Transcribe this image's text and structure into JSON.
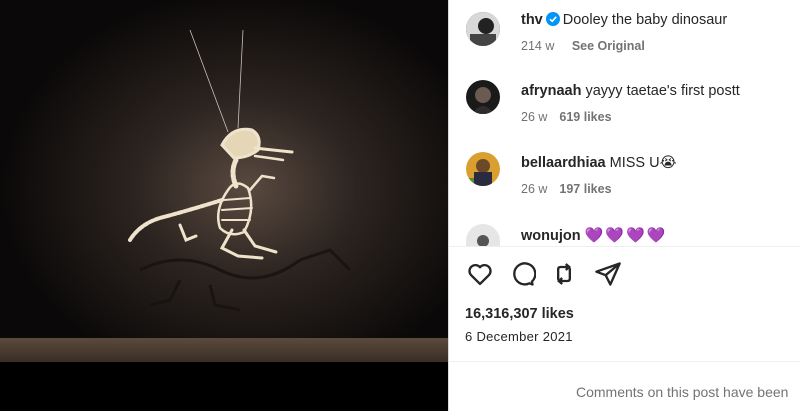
{
  "media": {
    "alt_subject": "dinosaur-skeleton-model"
  },
  "caption": {
    "username": "thv",
    "text": "Dooley the baby dinosaur",
    "time": "214 w",
    "see_original": "See Original",
    "verified_color": "#0095f6"
  },
  "comments": [
    {
      "username": "afrynaah",
      "text": "yayyy taetae's first postt",
      "time": "26 w",
      "likes": "619 likes"
    },
    {
      "username": "bellaardhiaa",
      "text": "MISS U😭",
      "time": "26 w",
      "likes": "197 likes"
    },
    {
      "username": "wonujon",
      "text": "💜💜💜💜"
    }
  ],
  "actions": {
    "like_icon": "heart-outline-icon",
    "comment_icon": "speech-bubble-icon",
    "repost_icon": "repost-arrows-icon",
    "share_icon": "paper-plane-icon"
  },
  "stats": {
    "likes": "16,316,307 likes",
    "date": "6 December 2021"
  },
  "footer": {
    "comments_closed": "Comments on this post have been"
  }
}
